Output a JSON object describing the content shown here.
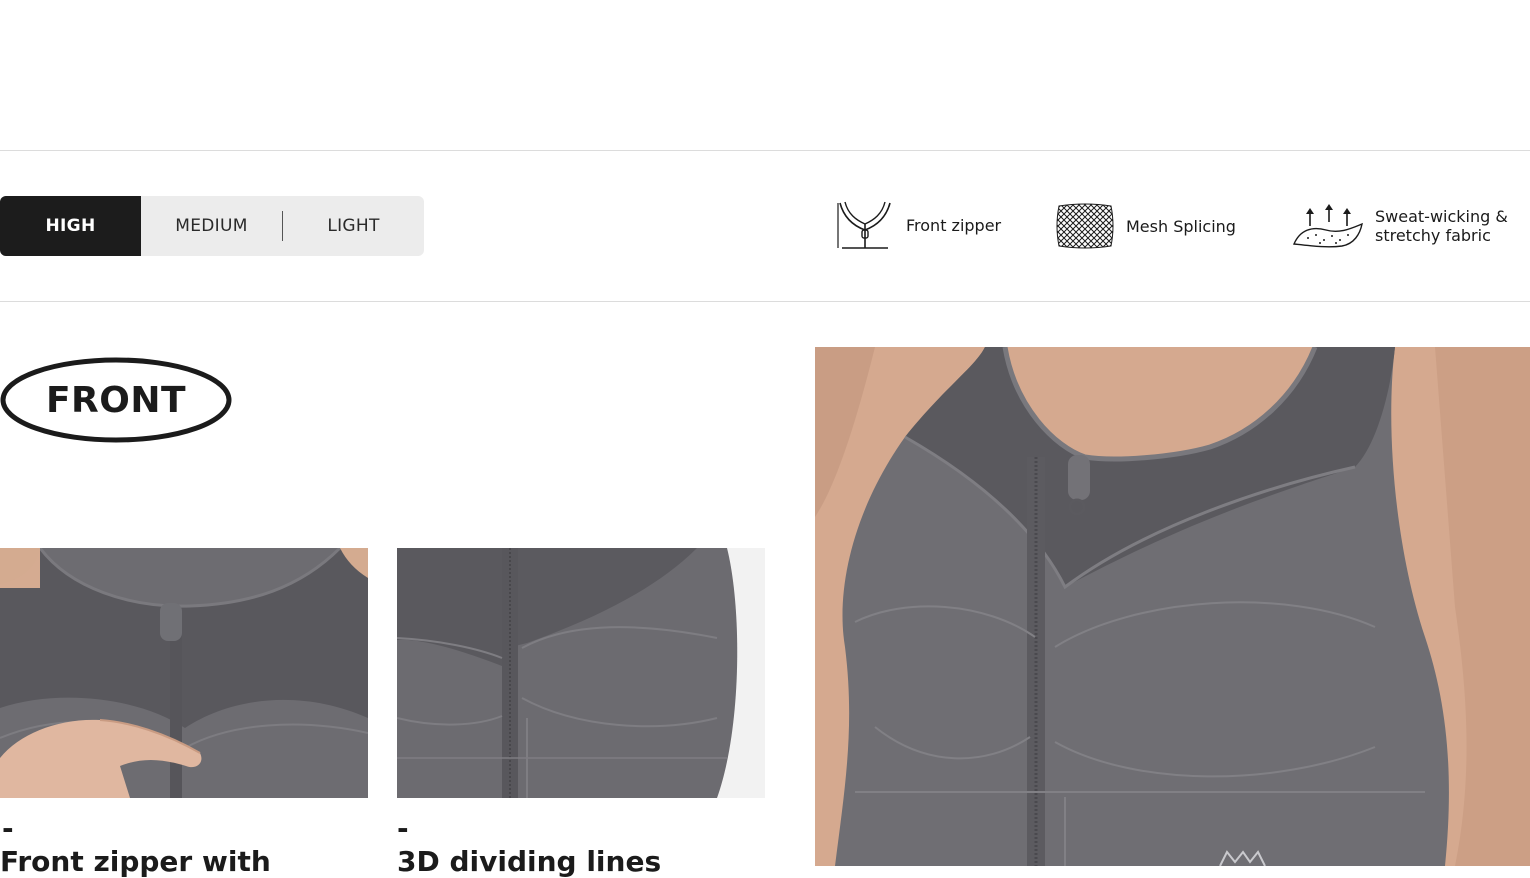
{
  "support_levels": {
    "items": [
      {
        "label": "HIGH",
        "active": true
      },
      {
        "label": "MEDIUM",
        "active": false
      },
      {
        "label": "LIGHT",
        "active": false
      }
    ]
  },
  "features": [
    {
      "icon": "front-zipper-icon",
      "label": "Front zipper"
    },
    {
      "icon": "mesh-icon",
      "label": "Mesh Splicing"
    },
    {
      "icon": "sweat-wicking-icon",
      "label_line1": "Sweat-wicking &",
      "label_line2": "stretchy fabric"
    }
  ],
  "section": {
    "badge": "FRONT"
  },
  "details": [
    {
      "dash": "-",
      "caption": "Front zipper with"
    },
    {
      "dash": "-",
      "caption": "3D dividing lines"
    }
  ],
  "colors": {
    "fabric": "#6e6d72",
    "mesh": "#58575c",
    "skin": "#d7ab90",
    "dark": "#1c1c1c",
    "toggle_bg": "#ececec"
  }
}
